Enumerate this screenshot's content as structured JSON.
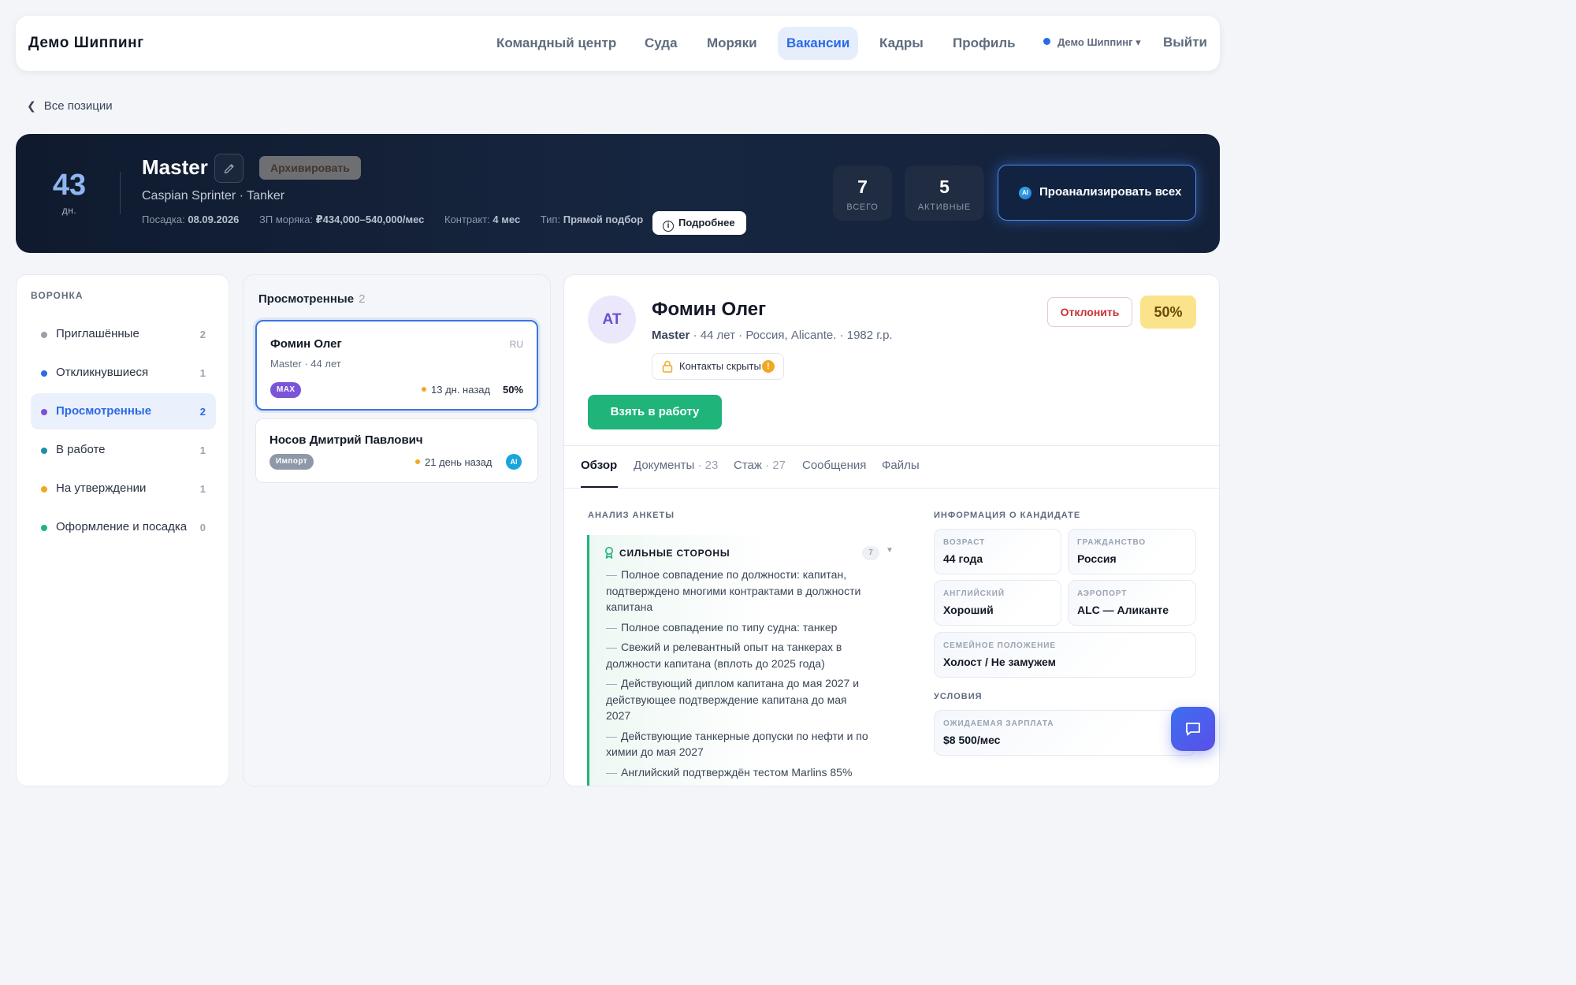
{
  "nav": {
    "brand": "Демо Шиппинг",
    "items": [
      "Командный центр",
      "Суда",
      "Моряки",
      "Вакансии",
      "Кадры",
      "Профиль"
    ],
    "active_item": "Вакансии",
    "company": "Демо Шиппинг ▾",
    "logout": "Выйти"
  },
  "back_link": "Все позиции",
  "vacancy": {
    "days_number": "43",
    "days_label": "дн.",
    "title": "Master",
    "archive_label": "Архивировать",
    "vessel": "Caspian Sprinter · Tanker",
    "meta": {
      "boarding_label": "Посадка:",
      "boarding_value": "08.09.2026",
      "salary_label": "ЗП моряка:",
      "salary_value": "₽434,000–540,000/мес",
      "contract_label": "Контракт:",
      "contract_value": "4 мес",
      "type_label": "Тип:",
      "type_value": "Прямой подбор"
    },
    "details_label": "Подробнее",
    "stats": [
      {
        "value": "7",
        "label": "ВСЕГО"
      },
      {
        "value": "5",
        "label": "АКТИВНЫЕ"
      }
    ],
    "analyze_label": "Проанализировать всех",
    "ai_label": "AI"
  },
  "funnel": {
    "title": "ВОРОНКА",
    "stages": [
      {
        "label": "Приглашённые",
        "count": "2",
        "color": "#9aa0aa"
      },
      {
        "label": "Откликнувшиеся",
        "count": "1",
        "color": "#2b6ae6"
      },
      {
        "label": "Просмотренные",
        "count": "2",
        "color": "#7b4fd6"
      },
      {
        "label": "В работе",
        "count": "1",
        "color": "#1a8fa8"
      },
      {
        "label": "На утверждении",
        "count": "1",
        "color": "#f2a824"
      },
      {
        "label": "Оформление и посадка",
        "count": "0",
        "color": "#1fb47a"
      }
    ],
    "active_stage": "Просмотренные"
  },
  "list": {
    "title": "Просмотренные",
    "count": "2",
    "candidates": [
      {
        "name": "Фомин Олег",
        "sub": "Master · 44 лет",
        "lang": "RU",
        "badge": "MAX",
        "badge_color": "#7a55d8",
        "ago": "13 дн. назад",
        "score": "50%"
      },
      {
        "name": "Носов Дмитрий Павлович",
        "badge": "Импорт",
        "badge_color": "#8e98a8",
        "ago": "21 день назад",
        "ai": "AI"
      }
    ]
  },
  "detail": {
    "initials": "AT",
    "name": "Фомин Олег",
    "position": "Master",
    "sub_rest": " · 44 лет · Россия, Alicante. · 1982 г.р.",
    "contacts": "Контакты скрыты",
    "contacts_warn": "!",
    "take_label": "Взять в работу",
    "reject_label": "Отклонить",
    "score": "50%",
    "tabs": [
      {
        "label": "Обзор",
        "count": ""
      },
      {
        "label": "Документы",
        "count": " · 23"
      },
      {
        "label": "Стаж",
        "count": " · 27"
      },
      {
        "label": "Сообщения",
        "count": ""
      },
      {
        "label": "Файлы",
        "count": ""
      }
    ],
    "analysis_title": "АНАЛИЗ АНКЕТЫ",
    "strengths_title": "СИЛЬНЫЕ СТОРОНЫ",
    "strengths_count": "7",
    "strengths": [
      "Полное совпадение по должности: капитан, подтверждено многими контрактами в должности капитана",
      "Полное совпадение по типу судна: танкер",
      "Свежий и релевантный опыт на танкерах в должности капитана (вплоть до 2025 года)",
      "Действующий диплом капитана до мая 2027 и действующее подтверждение капитана до мая 2027",
      "Действующие танкерные допуски по нефти и по химии до мая 2027",
      "Английский подтверждён тестом Marlins 85%"
    ],
    "info_title": "ИНФОРМАЦИЯ О КАНДИДАТЕ",
    "info": [
      {
        "key": "ВОЗРАСТ",
        "value": "44 года"
      },
      {
        "key": "ГРАЖДАНСТВО",
        "value": "Россия"
      },
      {
        "key": "АНГЛИЙСКИЙ",
        "value": "Хороший"
      },
      {
        "key": "АЭРОПОРТ",
        "value": "ALC — Аликанте"
      },
      {
        "key": "СЕМЕЙНОЕ ПОЛОЖЕНИЕ",
        "value": "Холост / Не замужем"
      }
    ],
    "conditions_title": "УСЛОВИЯ",
    "conditions": [
      {
        "key": "ОЖИДАЕМАЯ ЗАРПЛАТА",
        "value": "$8 500/мес"
      }
    ]
  }
}
